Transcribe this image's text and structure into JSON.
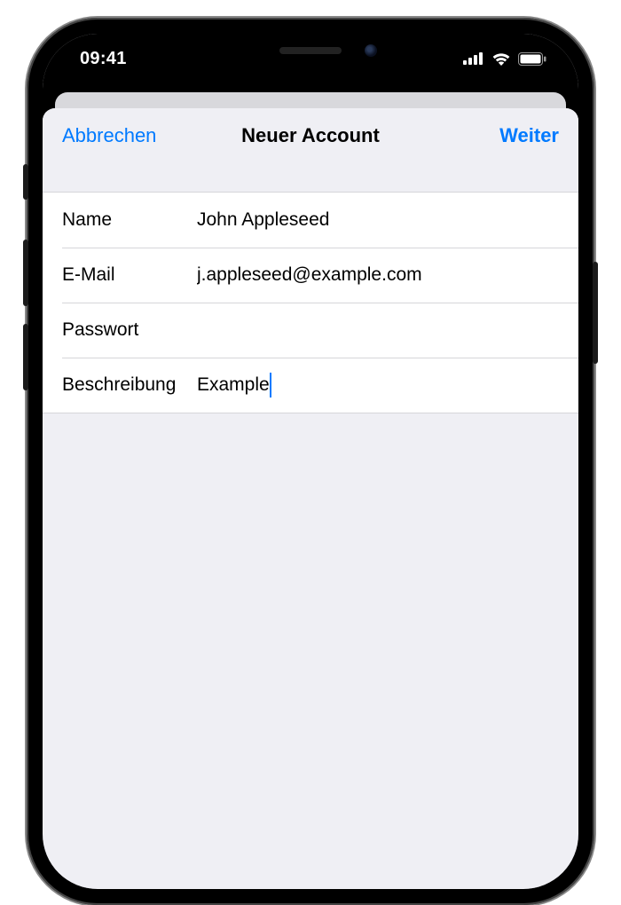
{
  "status": {
    "time": "09:41"
  },
  "modal": {
    "cancel": "Abbrechen",
    "title": "Neuer Account",
    "next": "Weiter"
  },
  "form": {
    "name": {
      "label": "Name",
      "value": "John Appleseed"
    },
    "email": {
      "label": "E-Mail",
      "value": "j.appleseed@example.com"
    },
    "password": {
      "label": "Passwort",
      "value": ""
    },
    "description": {
      "label": "Beschreibung",
      "value": "Example"
    }
  }
}
